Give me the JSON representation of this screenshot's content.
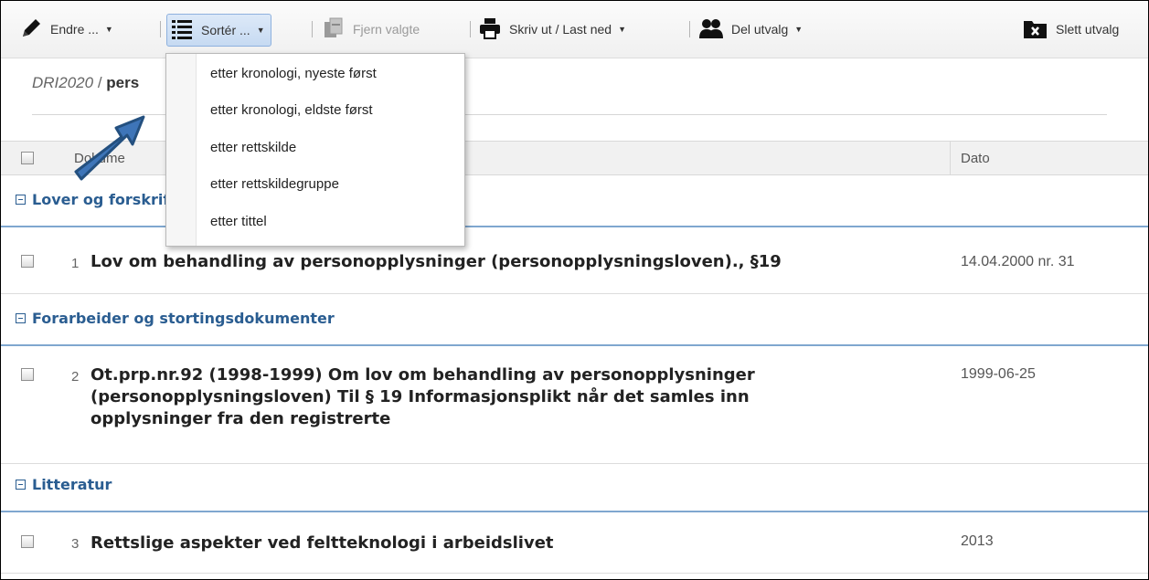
{
  "toolbar": {
    "edit_label": "Endre ...",
    "sort_label": "Sortér ...",
    "remove_label": "Fjern valgte",
    "print_label": "Skriv ut / Last ned",
    "share_label": "Del utvalg",
    "delete_label": "Slett utvalg"
  },
  "breadcrumb": {
    "parent": "DRI2020",
    "separator": " / ",
    "current": "pers"
  },
  "table_header": {
    "document": "Dokume",
    "date": "Dato"
  },
  "sort_menu": {
    "items": [
      "etter kronologi, nyeste først",
      "etter kronologi, eldste først",
      "etter rettskilde",
      "etter rettskildegruppe",
      "etter tittel"
    ]
  },
  "groups": [
    {
      "title": "Lover og forskrifter",
      "rows": [
        {
          "num": "1",
          "title": "Lov om behandling av personopplysninger (personopplysningsloven)., §19",
          "date": "14.04.2000 nr. 31"
        }
      ]
    },
    {
      "title": "Forarbeider og stortingsdokumenter",
      "rows": [
        {
          "num": "2",
          "title_lines": [
            "Ot.prp.nr.92 (1998-1999) Om lov om behandling av personopplysninger",
            "(personopplysningsloven) Til § 19 Informasjonsplikt når det samles inn",
            "opplysninger fra den registrerte"
          ],
          "date": "1999-06-25"
        }
      ]
    },
    {
      "title": "Litteratur",
      "rows": [
        {
          "num": "3",
          "title": "Rettslige aspekter ved feltteknologi i arbeidslivet",
          "date": "2013"
        }
      ]
    }
  ],
  "colors": {
    "accent": "#2a5d91",
    "arrow": "#3e75b8",
    "highlight": "#c6daf2"
  },
  "icons": [
    "pencil-icon",
    "list-icon",
    "remove-doc-icon",
    "printer-icon",
    "people-icon",
    "delete-folder-icon"
  ]
}
